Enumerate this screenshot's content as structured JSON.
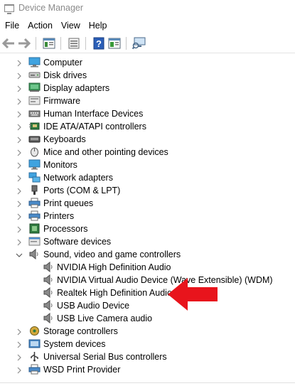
{
  "window": {
    "title": "Device Manager"
  },
  "menu": [
    "File",
    "Action",
    "View",
    "Help"
  ],
  "toolbar": {
    "buttons": [
      "back-icon",
      "forward-icon",
      "properties-icon",
      "view-icon",
      "help-icon",
      "driver-icon",
      "monitor-scan-icon"
    ]
  },
  "tree": {
    "categories": [
      {
        "label": "Computer",
        "icon": "computer-icon",
        "expanded": false
      },
      {
        "label": "Disk drives",
        "icon": "disk-icon",
        "expanded": false
      },
      {
        "label": "Display adapters",
        "icon": "display-icon",
        "expanded": false
      },
      {
        "label": "Firmware",
        "icon": "firmware-icon",
        "expanded": false
      },
      {
        "label": "Human Interface Devices",
        "icon": "hid-icon",
        "expanded": false
      },
      {
        "label": "IDE ATA/ATAPI controllers",
        "icon": "ide-icon",
        "expanded": false
      },
      {
        "label": "Keyboards",
        "icon": "keyboard-icon",
        "expanded": false
      },
      {
        "label": "Mice and other pointing devices",
        "icon": "mouse-icon",
        "expanded": false
      },
      {
        "label": "Monitors",
        "icon": "monitor-icon",
        "expanded": false
      },
      {
        "label": "Network adapters",
        "icon": "network-icon",
        "expanded": false
      },
      {
        "label": "Ports (COM & LPT)",
        "icon": "port-icon",
        "expanded": false
      },
      {
        "label": "Print queues",
        "icon": "printer-icon",
        "expanded": false
      },
      {
        "label": "Printers",
        "icon": "printer-icon",
        "expanded": false
      },
      {
        "label": "Processors",
        "icon": "processor-icon",
        "expanded": false
      },
      {
        "label": "Software devices",
        "icon": "software-icon",
        "expanded": false
      },
      {
        "label": "Sound, video and game controllers",
        "icon": "speaker-icon",
        "expanded": true
      },
      {
        "label": "Storage controllers",
        "icon": "storage-icon",
        "expanded": false
      },
      {
        "label": "System devices",
        "icon": "system-icon",
        "expanded": false
      },
      {
        "label": "Universal Serial Bus controllers",
        "icon": "usb-icon",
        "expanded": false
      },
      {
        "label": "WSD Print Provider",
        "icon": "printer-icon",
        "expanded": false
      }
    ],
    "sound_children": [
      "NVIDIA High Definition Audio",
      "NVIDIA Virtual Audio Device (Wave Extensible) (WDM)",
      "Realtek High Definition Audio",
      "USB Audio Device",
      "USB Live Camera audio"
    ]
  },
  "annotation": {
    "arrow_color": "#e8141c",
    "points_to": "Realtek High Definition Audio"
  }
}
